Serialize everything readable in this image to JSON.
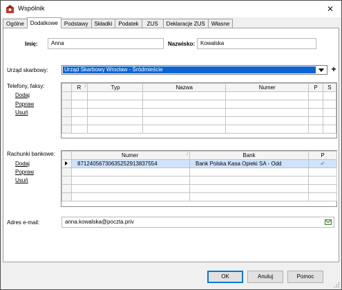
{
  "window": {
    "title": "Wspólnik",
    "close_symbol": "✕"
  },
  "tabs": [
    {
      "label": "Ogólne",
      "active": false
    },
    {
      "label": "Dodatkowe",
      "active": true
    },
    {
      "label": "Podstawy",
      "active": false
    },
    {
      "label": "Składki",
      "active": false
    },
    {
      "label": "Podatek",
      "active": false
    },
    {
      "label": "ZUS",
      "active": false
    },
    {
      "label": "Deklaracje ZUS",
      "active": false
    },
    {
      "label": "Własne",
      "active": false
    }
  ],
  "form": {
    "first_name_label": "Imię:",
    "first_name_value": "Anna",
    "last_name_label": "Nazwisko:",
    "last_name_value": "Kowalska",
    "tax_office_label": "Urząd skarbowy:",
    "tax_office_value": "Urząd Skarbowy Wrocław - Śródmieście",
    "add_symbol": "+",
    "email_label": "Adres e-mail:",
    "email_value": "anna.kowalska@poczta.priv"
  },
  "phones": {
    "label": "Telefony, faksy:",
    "actions": [
      "Dodaj",
      "Popraw",
      "Usuń"
    ],
    "columns": [
      "R",
      "Typ",
      "Nazwa",
      "Numer",
      "P",
      "S"
    ],
    "rows": []
  },
  "bank_accounts": {
    "label": "Rachunki bankowe:",
    "actions": [
      "Dodaj",
      "Popraw",
      "Usuń"
    ],
    "columns": [
      "Numer",
      "Bank",
      "P"
    ],
    "rows": [
      {
        "numer": "87124056730635252913837554",
        "bank": "Bank Polska Kasa Opieki SA  - Odd",
        "p": "✔",
        "selected": true
      }
    ]
  },
  "buttons": {
    "ok": "OK",
    "cancel": "Anuluj",
    "help": "Pomoc"
  },
  "colors": {
    "selection": "#0a64d2",
    "row_highlight": "#cfe3fa",
    "title_icon": "#c0392b"
  }
}
